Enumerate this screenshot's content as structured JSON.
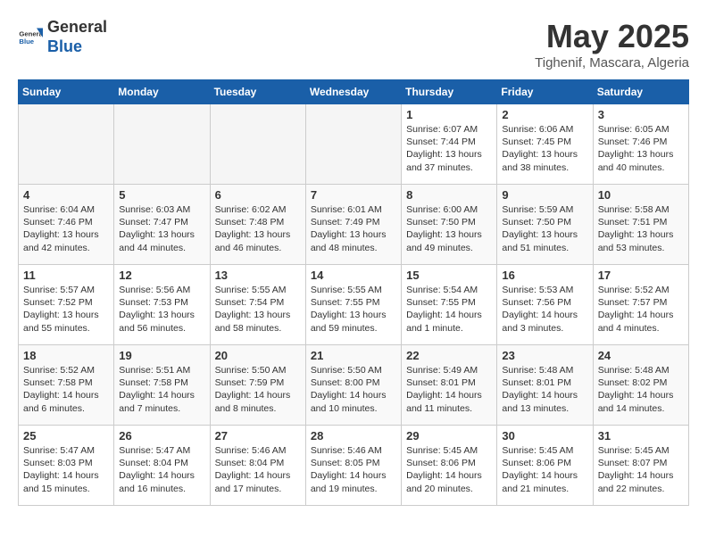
{
  "logo": {
    "general": "General",
    "blue": "Blue"
  },
  "title": "May 2025",
  "subtitle": "Tighenif, Mascara, Algeria",
  "headers": [
    "Sunday",
    "Monday",
    "Tuesday",
    "Wednesday",
    "Thursday",
    "Friday",
    "Saturday"
  ],
  "weeks": [
    [
      {
        "day": "",
        "content": ""
      },
      {
        "day": "",
        "content": ""
      },
      {
        "day": "",
        "content": ""
      },
      {
        "day": "",
        "content": ""
      },
      {
        "day": "1",
        "content": "Sunrise: 6:07 AM\nSunset: 7:44 PM\nDaylight: 13 hours\nand 37 minutes."
      },
      {
        "day": "2",
        "content": "Sunrise: 6:06 AM\nSunset: 7:45 PM\nDaylight: 13 hours\nand 38 minutes."
      },
      {
        "day": "3",
        "content": "Sunrise: 6:05 AM\nSunset: 7:46 PM\nDaylight: 13 hours\nand 40 minutes."
      }
    ],
    [
      {
        "day": "4",
        "content": "Sunrise: 6:04 AM\nSunset: 7:46 PM\nDaylight: 13 hours\nand 42 minutes."
      },
      {
        "day": "5",
        "content": "Sunrise: 6:03 AM\nSunset: 7:47 PM\nDaylight: 13 hours\nand 44 minutes."
      },
      {
        "day": "6",
        "content": "Sunrise: 6:02 AM\nSunset: 7:48 PM\nDaylight: 13 hours\nand 46 minutes."
      },
      {
        "day": "7",
        "content": "Sunrise: 6:01 AM\nSunset: 7:49 PM\nDaylight: 13 hours\nand 48 minutes."
      },
      {
        "day": "8",
        "content": "Sunrise: 6:00 AM\nSunset: 7:50 PM\nDaylight: 13 hours\nand 49 minutes."
      },
      {
        "day": "9",
        "content": "Sunrise: 5:59 AM\nSunset: 7:50 PM\nDaylight: 13 hours\nand 51 minutes."
      },
      {
        "day": "10",
        "content": "Sunrise: 5:58 AM\nSunset: 7:51 PM\nDaylight: 13 hours\nand 53 minutes."
      }
    ],
    [
      {
        "day": "11",
        "content": "Sunrise: 5:57 AM\nSunset: 7:52 PM\nDaylight: 13 hours\nand 55 minutes."
      },
      {
        "day": "12",
        "content": "Sunrise: 5:56 AM\nSunset: 7:53 PM\nDaylight: 13 hours\nand 56 minutes."
      },
      {
        "day": "13",
        "content": "Sunrise: 5:55 AM\nSunset: 7:54 PM\nDaylight: 13 hours\nand 58 minutes."
      },
      {
        "day": "14",
        "content": "Sunrise: 5:55 AM\nSunset: 7:55 PM\nDaylight: 13 hours\nand 59 minutes."
      },
      {
        "day": "15",
        "content": "Sunrise: 5:54 AM\nSunset: 7:55 PM\nDaylight: 14 hours\nand 1 minute."
      },
      {
        "day": "16",
        "content": "Sunrise: 5:53 AM\nSunset: 7:56 PM\nDaylight: 14 hours\nand 3 minutes."
      },
      {
        "day": "17",
        "content": "Sunrise: 5:52 AM\nSunset: 7:57 PM\nDaylight: 14 hours\nand 4 minutes."
      }
    ],
    [
      {
        "day": "18",
        "content": "Sunrise: 5:52 AM\nSunset: 7:58 PM\nDaylight: 14 hours\nand 6 minutes."
      },
      {
        "day": "19",
        "content": "Sunrise: 5:51 AM\nSunset: 7:58 PM\nDaylight: 14 hours\nand 7 minutes."
      },
      {
        "day": "20",
        "content": "Sunrise: 5:50 AM\nSunset: 7:59 PM\nDaylight: 14 hours\nand 8 minutes."
      },
      {
        "day": "21",
        "content": "Sunrise: 5:50 AM\nSunset: 8:00 PM\nDaylight: 14 hours\nand 10 minutes."
      },
      {
        "day": "22",
        "content": "Sunrise: 5:49 AM\nSunset: 8:01 PM\nDaylight: 14 hours\nand 11 minutes."
      },
      {
        "day": "23",
        "content": "Sunrise: 5:48 AM\nSunset: 8:01 PM\nDaylight: 14 hours\nand 13 minutes."
      },
      {
        "day": "24",
        "content": "Sunrise: 5:48 AM\nSunset: 8:02 PM\nDaylight: 14 hours\nand 14 minutes."
      }
    ],
    [
      {
        "day": "25",
        "content": "Sunrise: 5:47 AM\nSunset: 8:03 PM\nDaylight: 14 hours\nand 15 minutes."
      },
      {
        "day": "26",
        "content": "Sunrise: 5:47 AM\nSunset: 8:04 PM\nDaylight: 14 hours\nand 16 minutes."
      },
      {
        "day": "27",
        "content": "Sunrise: 5:46 AM\nSunset: 8:04 PM\nDaylight: 14 hours\nand 17 minutes."
      },
      {
        "day": "28",
        "content": "Sunrise: 5:46 AM\nSunset: 8:05 PM\nDaylight: 14 hours\nand 19 minutes."
      },
      {
        "day": "29",
        "content": "Sunrise: 5:45 AM\nSunset: 8:06 PM\nDaylight: 14 hours\nand 20 minutes."
      },
      {
        "day": "30",
        "content": "Sunrise: 5:45 AM\nSunset: 8:06 PM\nDaylight: 14 hours\nand 21 minutes."
      },
      {
        "day": "31",
        "content": "Sunrise: 5:45 AM\nSunset: 8:07 PM\nDaylight: 14 hours\nand 22 minutes."
      }
    ]
  ]
}
